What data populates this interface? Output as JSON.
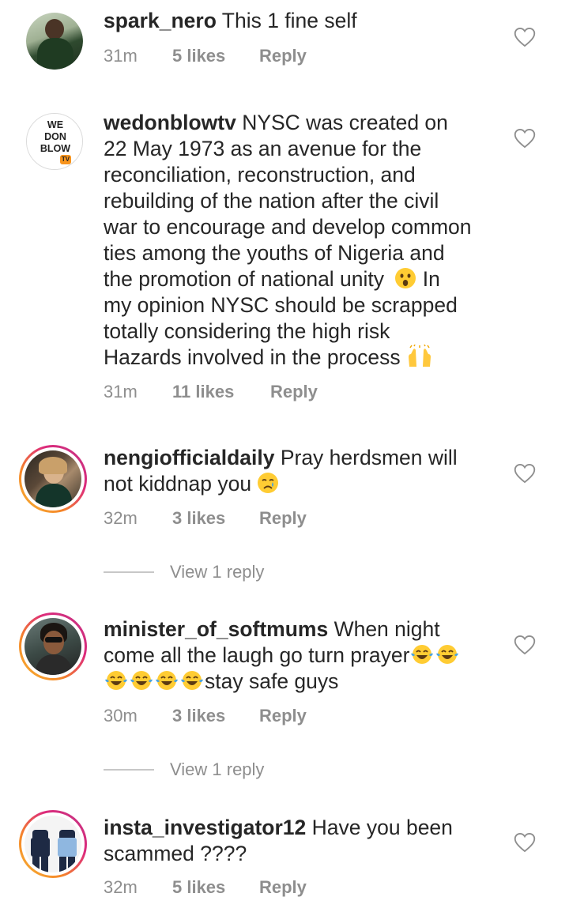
{
  "comments": [
    {
      "username": "spark_nero",
      "text": " This 1 fine self",
      "time": "31m",
      "likes": "5 likes",
      "reply": "Reply"
    },
    {
      "username": "wedonblowtv",
      "avatar_logo": [
        "WE",
        "DON",
        "BLOW",
        "TV"
      ],
      "text_line1": " NYSC was created on",
      "text_rest": [
        "22 May 1973 as an avenue for the",
        "reconciliation, reconstruction, and",
        "rebuilding of the nation after the civil",
        "war to encourage and develop common",
        "ties among the youths of Nigeria and",
        "the promotion of national unity"
      ],
      "text_after_emoji": " In",
      "text_tail": [
        "my opinion NYSC should be scrapped",
        "totally considering the high risk",
        "Hazards involved in the process "
      ],
      "emoji1": "astonished-face-emoji",
      "emoji2": "raising-hands-emoji",
      "time": "31m",
      "likes": "11 likes",
      "reply": "Reply"
    },
    {
      "username": "nengiofficialdaily",
      "text": " Pray herdsmen will",
      "text_line2": "not kiddnap you ",
      "emoji": "crying-face-emoji",
      "time": "32m",
      "likes": "3 likes",
      "reply": "Reply",
      "view_replies": "View 1 reply"
    },
    {
      "username": "minister_of_softmums",
      "text": " When night",
      "text_line2": "come all the laugh go turn prayer",
      "text_line3_after": "stay safe guys",
      "emoji": "tears-of-joy-emoji",
      "time": "30m",
      "likes": "3 likes",
      "reply": "Reply",
      "view_replies": "View 1 reply"
    },
    {
      "username": "insta_investigator12",
      "text": " Have you been",
      "text_line2": "scammed ????",
      "time": "32m",
      "likes": "5 likes",
      "reply": "Reply"
    }
  ],
  "colors": {
    "text": "#262626",
    "meta": "#8e8e8e",
    "story_ring": [
      "#f7b733",
      "#dd2a7b",
      "#c13584"
    ]
  }
}
